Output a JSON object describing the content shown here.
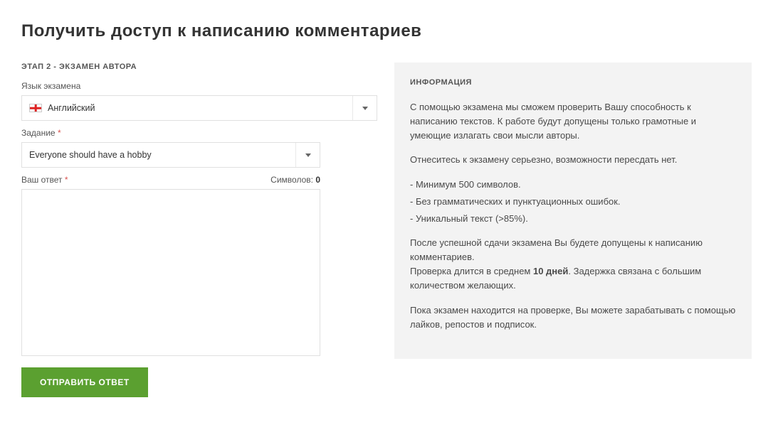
{
  "page_title": "Получить доступ к написанию комментариев",
  "step_heading": "ЭТАП 2 - ЭКЗАМЕН АВТОРА",
  "form": {
    "language": {
      "label": "Язык экзамена",
      "value": "Английский"
    },
    "task": {
      "label": "Задание",
      "value": "Everyone should have a hobby"
    },
    "answer": {
      "label": "Ваш ответ",
      "char_label": "Символов:",
      "char_count": "0"
    },
    "submit_label": "ОТПРАВИТЬ ОТВЕТ"
  },
  "info": {
    "heading": "ИНФОРМАЦИЯ",
    "p1": "С помощью экзамена мы сможем проверить Вашу способность к написанию текстов. К работе будут допущены только грамотные и умеющие излагать свои мысли авторы.",
    "p2": "Отнеситесь к экзамену серьезно, возможности пересдать нет.",
    "bullet1": "- Минимум 500 символов.",
    "bullet2": "- Без грамматических и пунктуационных ошибок.",
    "bullet3": "- Уникальный текст (>85%).",
    "p3a": "После успешной сдачи экзамена Вы будете допущены к написанию комментариев.",
    "p3b_prefix": "Проверка длится в среднем ",
    "p3b_bold": "10 дней",
    "p3b_suffix": ". Задержка связана с большим количеством желающих.",
    "p4": "Пока экзамен находится на проверке, Вы можете зарабатывать с помощью лайков, репостов и подписок."
  }
}
